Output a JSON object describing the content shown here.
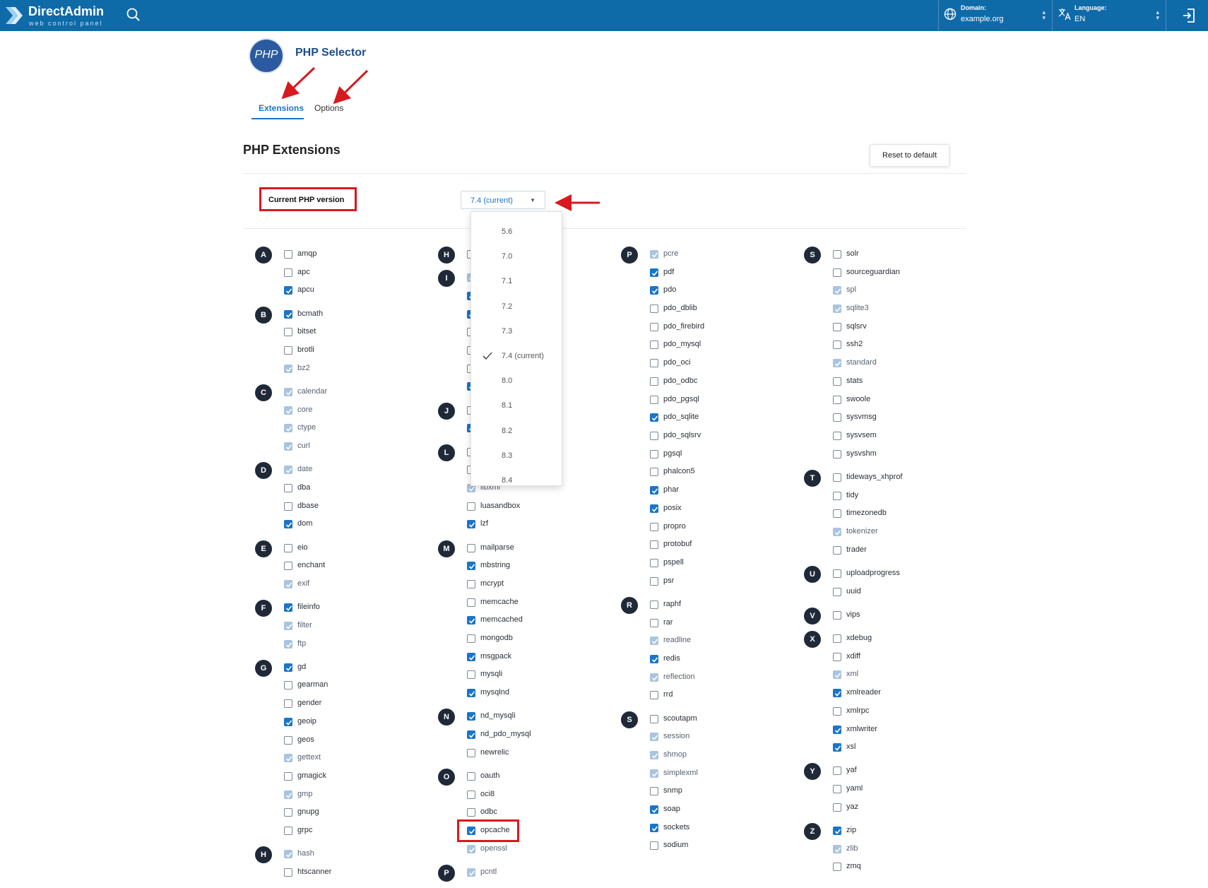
{
  "topbar": {
    "logo_title": "DirectAdmin",
    "logo_subtitle": "web control panel",
    "domain_label": "Domain:",
    "domain_value": "example.org",
    "language_label": "Language:",
    "language_value": "EN"
  },
  "header": {
    "logo_text": "PHP",
    "title": "PHP Selector",
    "tabs": [
      {
        "label": "Extensions",
        "active": true
      },
      {
        "label": "Options",
        "active": false
      }
    ]
  },
  "section": {
    "title": "PHP Extensions",
    "reset_label": "Reset to default",
    "version_label": "Current PHP version",
    "selected_version": "7.4 (current)"
  },
  "version_options": [
    {
      "label": "5.6",
      "checked": false
    },
    {
      "label": "7.0",
      "checked": false
    },
    {
      "label": "7.1",
      "checked": false
    },
    {
      "label": "7.2",
      "checked": false
    },
    {
      "label": "7.3",
      "checked": false
    },
    {
      "label": "7.4 (current)",
      "checked": true
    },
    {
      "label": "8.0",
      "checked": false
    },
    {
      "label": "8.1",
      "checked": false
    },
    {
      "label": "8.2",
      "checked": false
    },
    {
      "label": "8.3",
      "checked": false
    },
    {
      "label": "8.4",
      "checked": false
    }
  ],
  "columns": [
    [
      {
        "letter": "A",
        "items": [
          [
            "amqp",
            "off"
          ],
          [
            "apc",
            "off"
          ],
          [
            "apcu",
            "on"
          ]
        ]
      },
      {
        "letter": "B",
        "items": [
          [
            "bcmath",
            "on"
          ],
          [
            "bitset",
            "off"
          ],
          [
            "brotli",
            "off"
          ],
          [
            "bz2",
            "locked"
          ]
        ]
      },
      {
        "letter": "C",
        "items": [
          [
            "calendar",
            "locked"
          ],
          [
            "core",
            "locked"
          ],
          [
            "ctype",
            "locked"
          ],
          [
            "curl",
            "locked"
          ]
        ]
      },
      {
        "letter": "D",
        "items": [
          [
            "date",
            "locked"
          ],
          [
            "dba",
            "off"
          ],
          [
            "dbase",
            "off"
          ],
          [
            "dom",
            "on"
          ]
        ]
      },
      {
        "letter": "E",
        "items": [
          [
            "eio",
            "off"
          ],
          [
            "enchant",
            "off"
          ],
          [
            "exif",
            "locked"
          ]
        ]
      },
      {
        "letter": "F",
        "items": [
          [
            "fileinfo",
            "on"
          ],
          [
            "filter",
            "locked"
          ],
          [
            "ftp",
            "locked"
          ]
        ]
      },
      {
        "letter": "G",
        "items": [
          [
            "gd",
            "on"
          ],
          [
            "gearman",
            "off"
          ],
          [
            "gender",
            "off"
          ],
          [
            "geoip",
            "on"
          ],
          [
            "geos",
            "off"
          ],
          [
            "gettext",
            "locked"
          ],
          [
            "gmagick",
            "off"
          ],
          [
            "gmp",
            "locked"
          ],
          [
            "gnupg",
            "off"
          ],
          [
            "grpc",
            "off"
          ]
        ]
      },
      {
        "letter": "H",
        "items": [
          [
            "hash",
            "locked"
          ],
          [
            "htscanner",
            "off"
          ]
        ]
      }
    ],
    [
      {
        "letter": "H",
        "items": [
          [
            "",
            "off"
          ]
        ]
      },
      {
        "letter": "I",
        "items": [
          [
            "",
            "locked"
          ],
          [
            "",
            "on"
          ],
          [
            "",
            "on"
          ],
          [
            "",
            "off"
          ],
          [
            "",
            "off"
          ],
          [
            "",
            "off"
          ],
          [
            "",
            "on"
          ]
        ]
      },
      {
        "letter": "J",
        "items": [
          [
            "",
            "off"
          ],
          [
            "",
            "on"
          ]
        ]
      },
      {
        "letter": "L",
        "items": [
          [
            "",
            "off"
          ],
          [
            "",
            "off"
          ],
          [
            "libxml",
            "locked"
          ],
          [
            "luasandbox",
            "off"
          ],
          [
            "lzf",
            "on"
          ]
        ]
      },
      {
        "letter": "M",
        "items": [
          [
            "mailparse",
            "off"
          ],
          [
            "mbstring",
            "on"
          ],
          [
            "mcrypt",
            "off"
          ],
          [
            "memcache",
            "off"
          ],
          [
            "memcached",
            "on"
          ],
          [
            "mongodb",
            "off"
          ],
          [
            "msgpack",
            "on"
          ],
          [
            "mysqli",
            "off"
          ],
          [
            "mysqlnd",
            "on"
          ]
        ]
      },
      {
        "letter": "N",
        "items": [
          [
            "nd_mysqli",
            "on"
          ],
          [
            "nd_pdo_mysql",
            "on"
          ],
          [
            "newrelic",
            "off"
          ]
        ]
      },
      {
        "letter": "O",
        "items": [
          [
            "oauth",
            "off"
          ],
          [
            "oci8",
            "off"
          ],
          [
            "odbc",
            "off"
          ],
          [
            "opcache",
            "on"
          ],
          [
            "openssl",
            "locked"
          ]
        ]
      },
      {
        "letter": "P",
        "items": [
          [
            "pcntl",
            "locked"
          ]
        ]
      }
    ],
    [
      {
        "letter": "P",
        "items": [
          [
            "pcre",
            "locked"
          ],
          [
            "pdf",
            "on"
          ],
          [
            "pdo",
            "on"
          ],
          [
            "pdo_dblib",
            "off"
          ],
          [
            "pdo_firebird",
            "off"
          ],
          [
            "pdo_mysql",
            "off"
          ],
          [
            "pdo_oci",
            "off"
          ],
          [
            "pdo_odbc",
            "off"
          ],
          [
            "pdo_pgsql",
            "off"
          ],
          [
            "pdo_sqlite",
            "on"
          ],
          [
            "pdo_sqlsrv",
            "off"
          ],
          [
            "pgsql",
            "off"
          ],
          [
            "phalcon5",
            "off"
          ],
          [
            "phar",
            "on"
          ],
          [
            "posix",
            "on"
          ],
          [
            "propro",
            "off"
          ],
          [
            "protobuf",
            "off"
          ],
          [
            "pspell",
            "off"
          ],
          [
            "psr",
            "off"
          ]
        ]
      },
      {
        "letter": "R",
        "items": [
          [
            "raphf",
            "off"
          ],
          [
            "rar",
            "off"
          ],
          [
            "readline",
            "locked"
          ],
          [
            "redis",
            "on"
          ],
          [
            "reflection",
            "locked"
          ],
          [
            "rrd",
            "off"
          ]
        ]
      },
      {
        "letter": "S",
        "items": [
          [
            "scoutapm",
            "off"
          ],
          [
            "session",
            "locked"
          ],
          [
            "shmop",
            "locked"
          ],
          [
            "simplexml",
            "locked"
          ],
          [
            "snmp",
            "off"
          ],
          [
            "soap",
            "on"
          ],
          [
            "sockets",
            "on"
          ],
          [
            "sodium",
            "off"
          ]
        ]
      }
    ],
    [
      {
        "letter": "S",
        "items": [
          [
            "solr",
            "off"
          ],
          [
            "sourceguardian",
            "off"
          ],
          [
            "spl",
            "locked"
          ],
          [
            "sqlite3",
            "locked"
          ],
          [
            "sqlsrv",
            "off"
          ],
          [
            "ssh2",
            "off"
          ],
          [
            "standard",
            "locked"
          ],
          [
            "stats",
            "off"
          ],
          [
            "swoole",
            "off"
          ],
          [
            "sysvmsg",
            "off"
          ],
          [
            "sysvsem",
            "off"
          ],
          [
            "sysvshm",
            "off"
          ]
        ]
      },
      {
        "letter": "T",
        "items": [
          [
            "tideways_xhprof",
            "off"
          ],
          [
            "tidy",
            "off"
          ],
          [
            "timezonedb",
            "off"
          ],
          [
            "tokenizer",
            "locked"
          ],
          [
            "trader",
            "off"
          ]
        ]
      },
      {
        "letter": "U",
        "items": [
          [
            "uploadprogress",
            "off"
          ],
          [
            "uuid",
            "off"
          ]
        ]
      },
      {
        "letter": "V",
        "items": [
          [
            "vips",
            "off"
          ]
        ]
      },
      {
        "letter": "X",
        "items": [
          [
            "xdebug",
            "off"
          ],
          [
            "xdiff",
            "off"
          ],
          [
            "xml",
            "locked"
          ],
          [
            "xmlreader",
            "on"
          ],
          [
            "xmlrpc",
            "off"
          ],
          [
            "xmlwriter",
            "on"
          ],
          [
            "xsl",
            "on"
          ]
        ]
      },
      {
        "letter": "Y",
        "items": [
          [
            "yaf",
            "off"
          ],
          [
            "yaml",
            "off"
          ],
          [
            "yaz",
            "off"
          ]
        ]
      },
      {
        "letter": "Z",
        "items": [
          [
            "zip",
            "on"
          ],
          [
            "zlib",
            "locked"
          ],
          [
            "zmq",
            "off"
          ]
        ]
      }
    ]
  ]
}
